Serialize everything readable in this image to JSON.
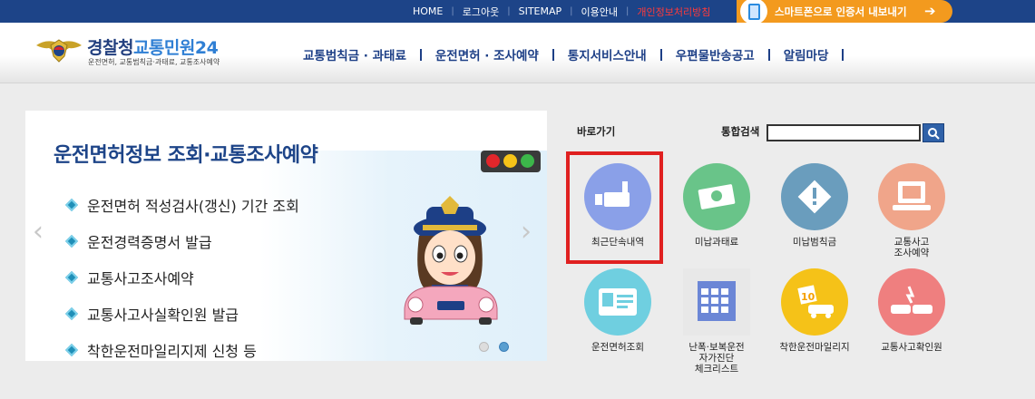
{
  "topbar": {
    "links": [
      "HOME",
      "로그아웃",
      "SITEMAP",
      "이용안내"
    ],
    "privacy": "개인정보처리방침",
    "smartphone_button": "스마트폰으로 인증서 내보내기",
    "arrow": "➔"
  },
  "header": {
    "logo_title_a": "경찰청",
    "logo_title_b": "교통민원24",
    "logo_subtitle": "운전면허, 교통범칙금·과태료, 교통조사예약",
    "nav": [
      "교통범칙금 · 과태료",
      "운전면허 · 조사예약",
      "통지서비스안내",
      "우편물반송공고",
      "알림마당"
    ]
  },
  "banner": {
    "title": "운전면허정보 조회·교통조사예약",
    "items": [
      "운전면허 적성검사(갱신) 기간 조회",
      "운전경력증명서 발급",
      "교통사고조사예약",
      "교통사고사실확인원 발급",
      "착한운전마일리지제 신청 등"
    ],
    "prev": "‹",
    "next": "›"
  },
  "quick": {
    "label": "바로가기",
    "search_label": "통합검색",
    "search_value": "",
    "items": [
      {
        "label": "최근단속내역",
        "icon": "camera-icon",
        "color": "#8aa0e8"
      },
      {
        "label": "미납과태료",
        "icon": "money-icon",
        "color": "#69c489"
      },
      {
        "label": "미납범칙금",
        "icon": "warning-icon",
        "color": "#6a9dbd"
      },
      {
        "label": "교통사고\n조사예약",
        "icon": "computer-icon",
        "color": "#f0a58a"
      },
      {
        "label": "운전면허조회",
        "icon": "license-card-icon",
        "color": "#6fcfe0"
      },
      {
        "label": "난폭·보복운전\n자가진단\n체크리스트",
        "icon": "calendar-checklist-icon",
        "color": "#6b86d6"
      },
      {
        "label": "착한운전마일리지",
        "icon": "mileage-car-icon",
        "color": "#f5c218"
      },
      {
        "label": "교통사고확인원",
        "icon": "car-crash-icon",
        "color": "#ef7f7f"
      }
    ]
  }
}
